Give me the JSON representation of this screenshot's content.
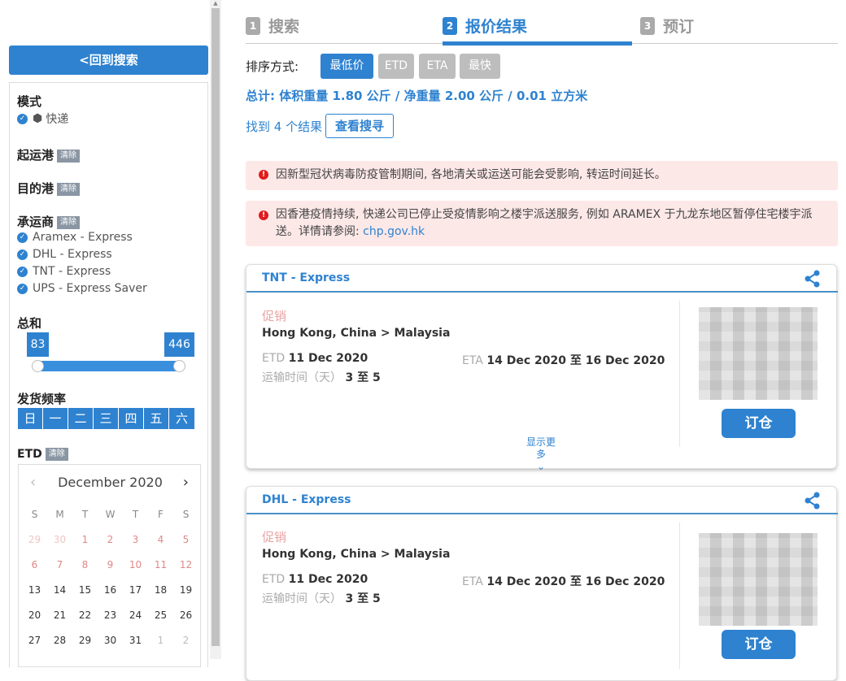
{
  "sidebar": {
    "back_label": "<回到搜索",
    "mode_title": "模式",
    "mode_value": "快递",
    "origin_title": "起运港",
    "dest_title": "目的港",
    "carrier_title": "承运商",
    "clear_label": "清除",
    "carriers": [
      "Aramex - Express",
      "DHL - Express",
      "TNT - Express",
      "UPS - Express Saver"
    ],
    "total_title": "总和",
    "range_min": "83",
    "range_max": "446",
    "freq_title": "发货频率",
    "weekdays": [
      "日",
      "一",
      "二",
      "三",
      "四",
      "五",
      "六"
    ],
    "etd_title": "ETD",
    "calendar": {
      "month": "December 2020",
      "dow": [
        "S",
        "M",
        "T",
        "W",
        "T",
        "F",
        "S"
      ],
      "rows": [
        [
          "29",
          "30",
          "1",
          "2",
          "3",
          "4",
          "5"
        ],
        [
          "6",
          "7",
          "8",
          "9",
          "10",
          "11",
          "12"
        ],
        [
          "13",
          "14",
          "15",
          "16",
          "17",
          "18",
          "19"
        ],
        [
          "20",
          "21",
          "22",
          "23",
          "24",
          "25",
          "26"
        ],
        [
          "27",
          "28",
          "29",
          "30",
          "31",
          "1",
          "2"
        ]
      ]
    }
  },
  "steps": [
    {
      "num": "1",
      "label": "搜索"
    },
    {
      "num": "2",
      "label": "报价结果"
    },
    {
      "num": "3",
      "label": "预订"
    }
  ],
  "sort": {
    "label": "排序方式:",
    "options": [
      "最低价",
      "ETD",
      "ETA",
      "最快"
    ],
    "active": "最低价"
  },
  "total_line": "总计: 体积重量 1.80 公斤 / 净重量 2.00 公斤 / 0.01 立方米",
  "found_label": "找到 4 个结果",
  "view_search_label": "查看搜寻",
  "notices": [
    {
      "text": "因新型冠状病毒防疫管制期间, 各地清关或运送可能会受影响, 转运时间延长。"
    },
    {
      "text": "因香港疫情持续, 快递公司已停止受疫情影响之楼宇派送服务, 例如 ARAMEX 于九龙东地区暂停住宅楼宇派送。详情请参阅:",
      "link": "chp.gov.hk"
    }
  ],
  "results": [
    {
      "carrier": "TNT - Express",
      "promo": "促销",
      "route": "Hong Kong, China > Malaysia",
      "etd_label": "ETD",
      "etd": "11 Dec 2020",
      "eta_label": "ETA",
      "eta": "14 Dec 2020 至 16 Dec 2020",
      "transit_label": "运输时间（天）",
      "transit": "3 至 5",
      "more_label": "显示更多",
      "book_label": "订仓"
    },
    {
      "carrier": "DHL - Express",
      "promo": "促销",
      "route": "Hong Kong, China > Malaysia",
      "etd_label": "ETD",
      "etd": "11 Dec 2020",
      "eta_label": "ETA",
      "eta": "14 Dec 2020 至 16 Dec 2020",
      "transit_label": "运输时间（天）",
      "transit": "3 至 5",
      "book_label": "订仓"
    }
  ]
}
